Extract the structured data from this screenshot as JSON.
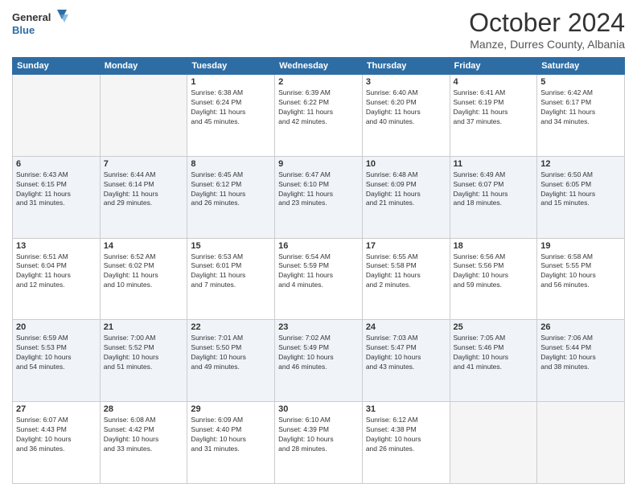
{
  "header": {
    "logo_line1": "General",
    "logo_line2": "Blue",
    "month": "October 2024",
    "location": "Manze, Durres County, Albania"
  },
  "weekdays": [
    "Sunday",
    "Monday",
    "Tuesday",
    "Wednesday",
    "Thursday",
    "Friday",
    "Saturday"
  ],
  "weeks": [
    [
      {
        "day": "",
        "info": ""
      },
      {
        "day": "",
        "info": ""
      },
      {
        "day": "1",
        "info": "Sunrise: 6:38 AM\nSunset: 6:24 PM\nDaylight: 11 hours\nand 45 minutes."
      },
      {
        "day": "2",
        "info": "Sunrise: 6:39 AM\nSunset: 6:22 PM\nDaylight: 11 hours\nand 42 minutes."
      },
      {
        "day": "3",
        "info": "Sunrise: 6:40 AM\nSunset: 6:20 PM\nDaylight: 11 hours\nand 40 minutes."
      },
      {
        "day": "4",
        "info": "Sunrise: 6:41 AM\nSunset: 6:19 PM\nDaylight: 11 hours\nand 37 minutes."
      },
      {
        "day": "5",
        "info": "Sunrise: 6:42 AM\nSunset: 6:17 PM\nDaylight: 11 hours\nand 34 minutes."
      }
    ],
    [
      {
        "day": "6",
        "info": "Sunrise: 6:43 AM\nSunset: 6:15 PM\nDaylight: 11 hours\nand 31 minutes."
      },
      {
        "day": "7",
        "info": "Sunrise: 6:44 AM\nSunset: 6:14 PM\nDaylight: 11 hours\nand 29 minutes."
      },
      {
        "day": "8",
        "info": "Sunrise: 6:45 AM\nSunset: 6:12 PM\nDaylight: 11 hours\nand 26 minutes."
      },
      {
        "day": "9",
        "info": "Sunrise: 6:47 AM\nSunset: 6:10 PM\nDaylight: 11 hours\nand 23 minutes."
      },
      {
        "day": "10",
        "info": "Sunrise: 6:48 AM\nSunset: 6:09 PM\nDaylight: 11 hours\nand 21 minutes."
      },
      {
        "day": "11",
        "info": "Sunrise: 6:49 AM\nSunset: 6:07 PM\nDaylight: 11 hours\nand 18 minutes."
      },
      {
        "day": "12",
        "info": "Sunrise: 6:50 AM\nSunset: 6:05 PM\nDaylight: 11 hours\nand 15 minutes."
      }
    ],
    [
      {
        "day": "13",
        "info": "Sunrise: 6:51 AM\nSunset: 6:04 PM\nDaylight: 11 hours\nand 12 minutes."
      },
      {
        "day": "14",
        "info": "Sunrise: 6:52 AM\nSunset: 6:02 PM\nDaylight: 11 hours\nand 10 minutes."
      },
      {
        "day": "15",
        "info": "Sunrise: 6:53 AM\nSunset: 6:01 PM\nDaylight: 11 hours\nand 7 minutes."
      },
      {
        "day": "16",
        "info": "Sunrise: 6:54 AM\nSunset: 5:59 PM\nDaylight: 11 hours\nand 4 minutes."
      },
      {
        "day": "17",
        "info": "Sunrise: 6:55 AM\nSunset: 5:58 PM\nDaylight: 11 hours\nand 2 minutes."
      },
      {
        "day": "18",
        "info": "Sunrise: 6:56 AM\nSunset: 5:56 PM\nDaylight: 10 hours\nand 59 minutes."
      },
      {
        "day": "19",
        "info": "Sunrise: 6:58 AM\nSunset: 5:55 PM\nDaylight: 10 hours\nand 56 minutes."
      }
    ],
    [
      {
        "day": "20",
        "info": "Sunrise: 6:59 AM\nSunset: 5:53 PM\nDaylight: 10 hours\nand 54 minutes."
      },
      {
        "day": "21",
        "info": "Sunrise: 7:00 AM\nSunset: 5:52 PM\nDaylight: 10 hours\nand 51 minutes."
      },
      {
        "day": "22",
        "info": "Sunrise: 7:01 AM\nSunset: 5:50 PM\nDaylight: 10 hours\nand 49 minutes."
      },
      {
        "day": "23",
        "info": "Sunrise: 7:02 AM\nSunset: 5:49 PM\nDaylight: 10 hours\nand 46 minutes."
      },
      {
        "day": "24",
        "info": "Sunrise: 7:03 AM\nSunset: 5:47 PM\nDaylight: 10 hours\nand 43 minutes."
      },
      {
        "day": "25",
        "info": "Sunrise: 7:05 AM\nSunset: 5:46 PM\nDaylight: 10 hours\nand 41 minutes."
      },
      {
        "day": "26",
        "info": "Sunrise: 7:06 AM\nSunset: 5:44 PM\nDaylight: 10 hours\nand 38 minutes."
      }
    ],
    [
      {
        "day": "27",
        "info": "Sunrise: 6:07 AM\nSunset: 4:43 PM\nDaylight: 10 hours\nand 36 minutes."
      },
      {
        "day": "28",
        "info": "Sunrise: 6:08 AM\nSunset: 4:42 PM\nDaylight: 10 hours\nand 33 minutes."
      },
      {
        "day": "29",
        "info": "Sunrise: 6:09 AM\nSunset: 4:40 PM\nDaylight: 10 hours\nand 31 minutes."
      },
      {
        "day": "30",
        "info": "Sunrise: 6:10 AM\nSunset: 4:39 PM\nDaylight: 10 hours\nand 28 minutes."
      },
      {
        "day": "31",
        "info": "Sunrise: 6:12 AM\nSunset: 4:38 PM\nDaylight: 10 hours\nand 26 minutes."
      },
      {
        "day": "",
        "info": ""
      },
      {
        "day": "",
        "info": ""
      }
    ]
  ]
}
